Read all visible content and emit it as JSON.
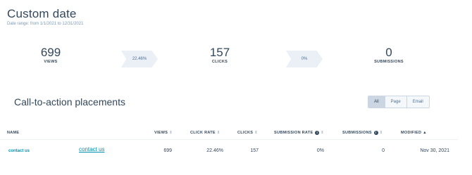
{
  "header": {
    "title": "Custom date",
    "date_range": "Date range: from 1/1/2021 to 12/31/2021"
  },
  "funnel": {
    "metrics": [
      {
        "value": "699",
        "label": "VIEWS"
      },
      {
        "value": "157",
        "label": "CLICKS"
      },
      {
        "value": "0",
        "label": "SUBMISSIONS"
      }
    ],
    "rates": [
      "22.46%",
      "0%"
    ]
  },
  "section": {
    "title": "Call-to-action placements",
    "filters": [
      {
        "label": "All",
        "active": true
      },
      {
        "label": "Page",
        "active": false
      },
      {
        "label": "Email",
        "active": false
      }
    ]
  },
  "table": {
    "columns": {
      "name": "NAME",
      "views": "VIEWS",
      "click_rate": "CLICK RATE",
      "clicks": "CLICKS",
      "submission_rate": "SUBMISSION RATE",
      "submissions": "SUBMISSIONS",
      "modified": "MODIFIED"
    },
    "rows": [
      {
        "name": "contact us",
        "placement": "contact us",
        "views": "699",
        "click_rate": "22.46%",
        "clicks": "157",
        "submission_rate": "0%",
        "submissions": "0",
        "modified": "Nov 30, 2021"
      }
    ]
  },
  "icons": {
    "sort": "sort-icon",
    "sort_active": "sort-ascending-icon",
    "info": "info-icon"
  },
  "colors": {
    "text": "#33475b",
    "link": "#0091ae",
    "chevron": "#eaf0f6",
    "active_filter": "#cbd6e2"
  }
}
